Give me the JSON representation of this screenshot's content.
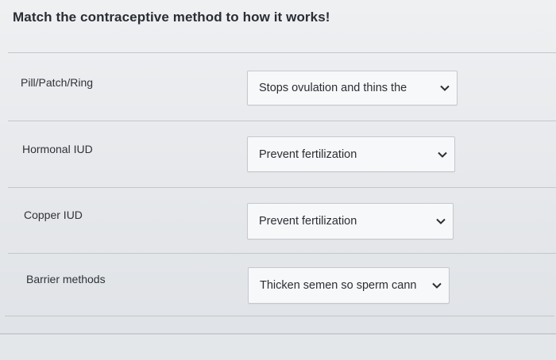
{
  "question": {
    "title": "Match the contraceptive method to how it works!"
  },
  "rows": [
    {
      "label": "Pill/Patch/Ring",
      "selected": "Stops ovulation and thins the"
    },
    {
      "label": "Hormonal IUD",
      "selected": "Prevent fertilization"
    },
    {
      "label": "Copper IUD",
      "selected": "Prevent fertilization"
    },
    {
      "label": "Barrier methods",
      "selected": "Thicken semen so sperm cann"
    }
  ],
  "icons": {
    "dropdown": "chevron-down-icon"
  },
  "colors": {
    "text": "#2a2d33",
    "border": "#c4c8ce",
    "select_bg": "#f7f8f9"
  }
}
